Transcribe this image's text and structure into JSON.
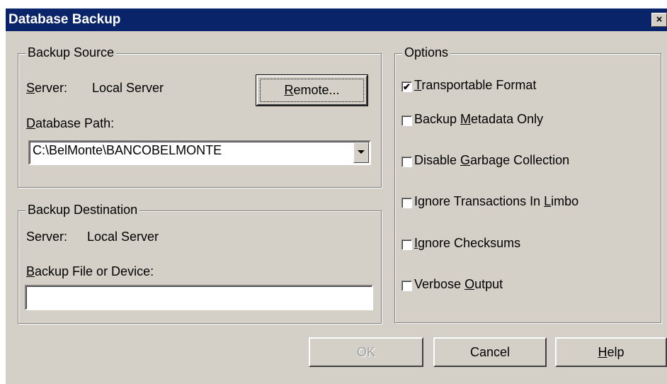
{
  "window": {
    "title": "Database Backup",
    "close_glyph": "×"
  },
  "backup_source": {
    "legend": "Backup Source",
    "server_label_first": "S",
    "server_label_rest": "erver:",
    "server_value": "Local Server",
    "remote_button_first": "R",
    "remote_button_rest": "emote...",
    "db_path_label_first": "D",
    "db_path_label_rest": "atabase Path:",
    "db_path_value": "C:\\BelMonte\\BANCOBELMONTE"
  },
  "backup_destination": {
    "legend": "Backup Destination",
    "server_label": "Server:",
    "server_value": "Local Server",
    "file_label_first": "B",
    "file_label_rest": "ackup File or Device:",
    "file_value": ""
  },
  "options": {
    "legend": "Options",
    "items": [
      {
        "pre": "",
        "key": "T",
        "post": "ransportable Format",
        "checked": true
      },
      {
        "pre": "Backup ",
        "key": "M",
        "post": "etadata Only",
        "checked": false
      },
      {
        "pre": "Disable ",
        "key": "G",
        "post": "arbage Collection",
        "checked": false
      },
      {
        "pre": "Ignore Transactions In ",
        "key": "L",
        "post": "imbo",
        "checked": false
      },
      {
        "pre": "",
        "key": "I",
        "post": "gnore Checksums",
        "checked": false
      },
      {
        "pre": "Verbose ",
        "key": "O",
        "post": "utput",
        "checked": false
      }
    ]
  },
  "buttons": {
    "ok": "OK",
    "cancel": "Cancel",
    "help_first": "H",
    "help_rest": "elp"
  },
  "colors": {
    "titlebar": "#0a246a",
    "face": "#d4d0c8",
    "title_text": "#ffffff"
  },
  "icons": {
    "checkbox_check": "✔",
    "dropdown": "chevron-down-icon"
  }
}
